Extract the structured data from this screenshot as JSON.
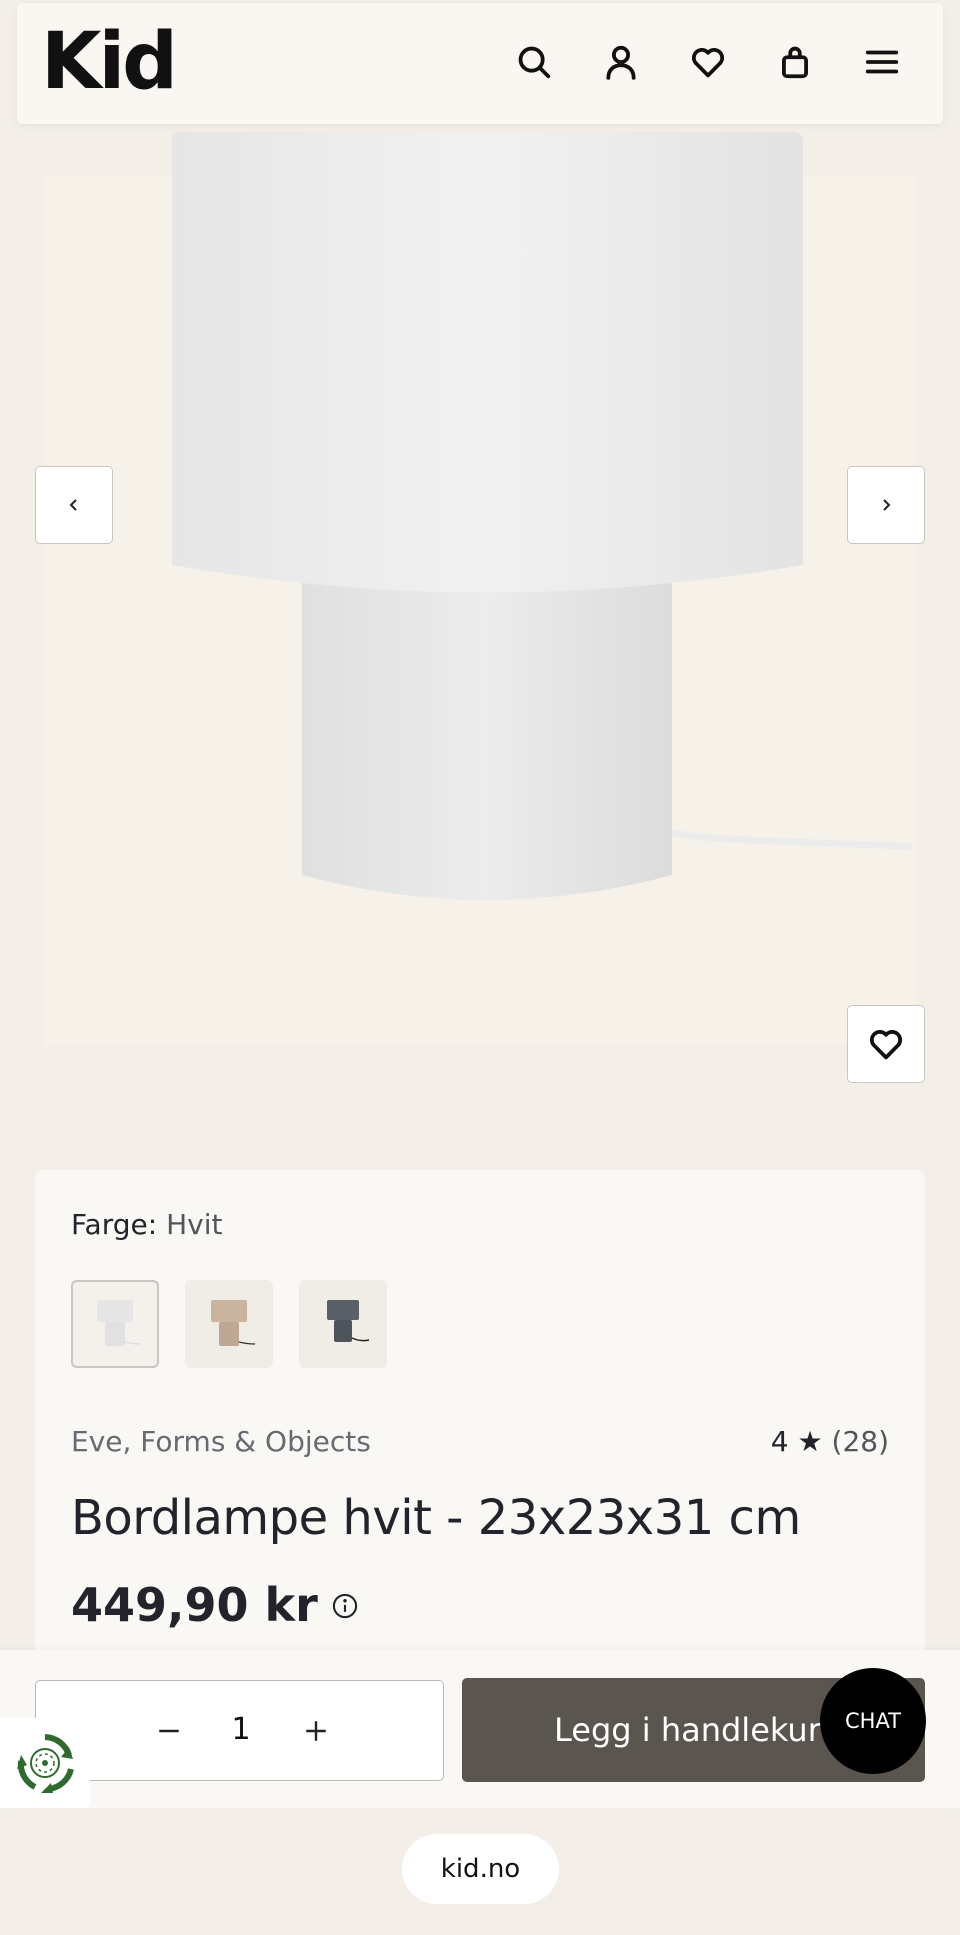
{
  "header": {
    "logo": "Kid",
    "icons": [
      "search-icon",
      "user-icon",
      "heart-icon",
      "bag-icon",
      "menu-icon"
    ]
  },
  "gallery": {
    "prev_icon": "chevron-left-icon",
    "next_icon": "chevron-right-icon",
    "favorite_icon": "heart-icon"
  },
  "product": {
    "color_label": "Farge:",
    "color_value": "Hvit",
    "swatches": [
      {
        "color": "#e9e9e9",
        "selected": true
      },
      {
        "color": "#c9b4a0",
        "selected": false
      },
      {
        "color": "#555a62",
        "selected": false
      }
    ],
    "brand": "Eve, Forms & Objects",
    "rating": "4 ★",
    "rating_count": "(28)",
    "title": "Bordlampe hvit - 23x23x31 cm",
    "price": "449,90 kr"
  },
  "cart": {
    "quantity": "1",
    "add_label": "Legg i handlekurv"
  },
  "chat": {
    "label": "CHAT"
  },
  "footer": {
    "domain": "kid.no"
  },
  "colors": {
    "page_bg": "#f3efe8",
    "add_button": "#5b554f",
    "chat": "#000000"
  }
}
